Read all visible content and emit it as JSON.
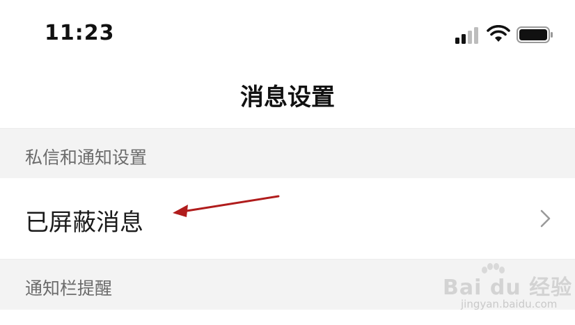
{
  "status_bar": {
    "time": "11:23",
    "icons": [
      "signal-icon",
      "wifi-icon",
      "battery-icon"
    ]
  },
  "header": {
    "title": "消息设置"
  },
  "sections": [
    {
      "header": "私信和通知设置",
      "items": [
        {
          "label": "已屏蔽消息",
          "icon": "chevron-right-icon"
        }
      ]
    },
    {
      "header": "通知栏提醒",
      "items": []
    }
  ],
  "annotation": {
    "arrow_color": "#b01c1c",
    "points_to": "已屏蔽消息"
  },
  "watermark": {
    "brand": "Bai du 经验",
    "url": "jingyan.baidu.com"
  },
  "colors": {
    "section_bg": "#f3f3f3",
    "text_primary": "#1a1a1a",
    "text_secondary": "#6b6b6b"
  }
}
